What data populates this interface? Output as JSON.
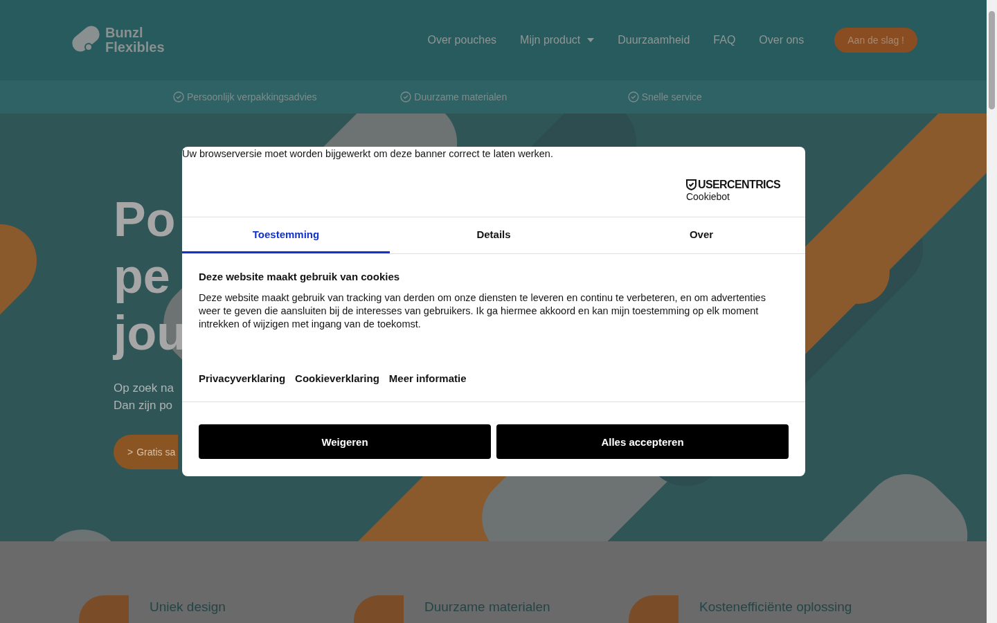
{
  "header": {
    "logo_lines": [
      "Bunzl",
      "Flexibles"
    ],
    "nav": [
      {
        "label": "Over pouches",
        "dropdown": false
      },
      {
        "label": "Mijn product",
        "dropdown": true
      },
      {
        "label": "Duurzaamheid",
        "dropdown": false
      },
      {
        "label": "FAQ",
        "dropdown": false
      },
      {
        "label": "Over ons",
        "dropdown": false
      }
    ],
    "cta": "Aan de slag !"
  },
  "usps": [
    "Persoonlijk verpakkingsadvies",
    "Duurzame materialen",
    "Snelle service"
  ],
  "hero": {
    "title_lines": [
      "Po",
      "pe",
      "jou"
    ],
    "subtitle_lines": [
      "Op zoek na",
      "Dan zijn po"
    ],
    "button_icon": ">",
    "button_label": "Gratis sa"
  },
  "features": [
    "Uniek design",
    "Duurzame materialen",
    "Kostenefficiënte oplossing"
  ],
  "cookie_dialog": {
    "notice": "Uw browserversie moet worden bijgewerkt om deze banner correct te laten werken.",
    "brand": "USERCENTRICS",
    "product": "Cookiebot",
    "tabs": [
      {
        "label": "Toestemming",
        "selected": true
      },
      {
        "label": "Details",
        "selected": false
      },
      {
        "label": "Over",
        "selected": false
      }
    ],
    "heading": "Deze website maakt gebruik van cookies",
    "body": "Deze website maakt gebruik van tracking van derden om onze diensten te leveren en continu te verbeteren, en om advertenties weer te geven die aansluiten bij de interesses van gebruikers. Ik ga hiermee akkoord en kan mijn toestemming op elk moment intrekken of wijzigen met ingang van de toekomst.",
    "links": [
      "Privacyverklaring",
      "Cookieverklaring",
      "Meer informatie"
    ],
    "buttons": [
      "Weigeren",
      "Alles accepteren"
    ]
  }
}
